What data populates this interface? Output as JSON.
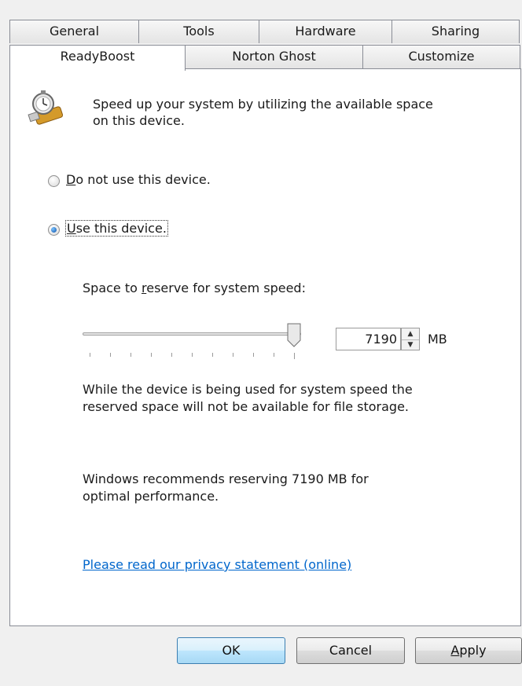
{
  "tabs": {
    "row1": [
      {
        "label": "General",
        "width": 165
      },
      {
        "label": "Tools",
        "width": 154
      },
      {
        "label": "Hardware",
        "width": 170
      },
      {
        "label": "Sharing",
        "width": 163
      }
    ],
    "row2": [
      {
        "label": "ReadyBoost",
        "width": 224,
        "active": true
      },
      {
        "label": "Norton Ghost",
        "width": 227
      },
      {
        "label": "Customize",
        "width": 201
      }
    ]
  },
  "header": {
    "description_line1": "Speed up your system by utilizing the available space",
    "description_line2": "on this device."
  },
  "options": {
    "do_not_use": {
      "mnemonic": "D",
      "rest": "o not use this device.",
      "selected": false
    },
    "use": {
      "mnemonic": "U",
      "rest": "se this device.",
      "selected": true
    }
  },
  "reserve": {
    "label_pre": "Space to ",
    "label_mnemonic": "r",
    "label_post": "eserve for system speed:",
    "value": "7190",
    "unit": "MB",
    "slider_fraction": 1.0
  },
  "info": {
    "line1": "While the device is being used for system speed the",
    "line2": "reserved space will not be available for file storage.",
    "rec_line1": "Windows recommends reserving 7190 MB for",
    "rec_line2": "optimal performance."
  },
  "privacy_link": "Please read our privacy statement (online)",
  "buttons": {
    "ok": "OK",
    "cancel": "Cancel",
    "apply_mnemonic": "A",
    "apply_rest": "pply"
  },
  "colors": {
    "link": "#0066cc",
    "panel": "#ffffff",
    "chrome": "#f0f0f0"
  }
}
